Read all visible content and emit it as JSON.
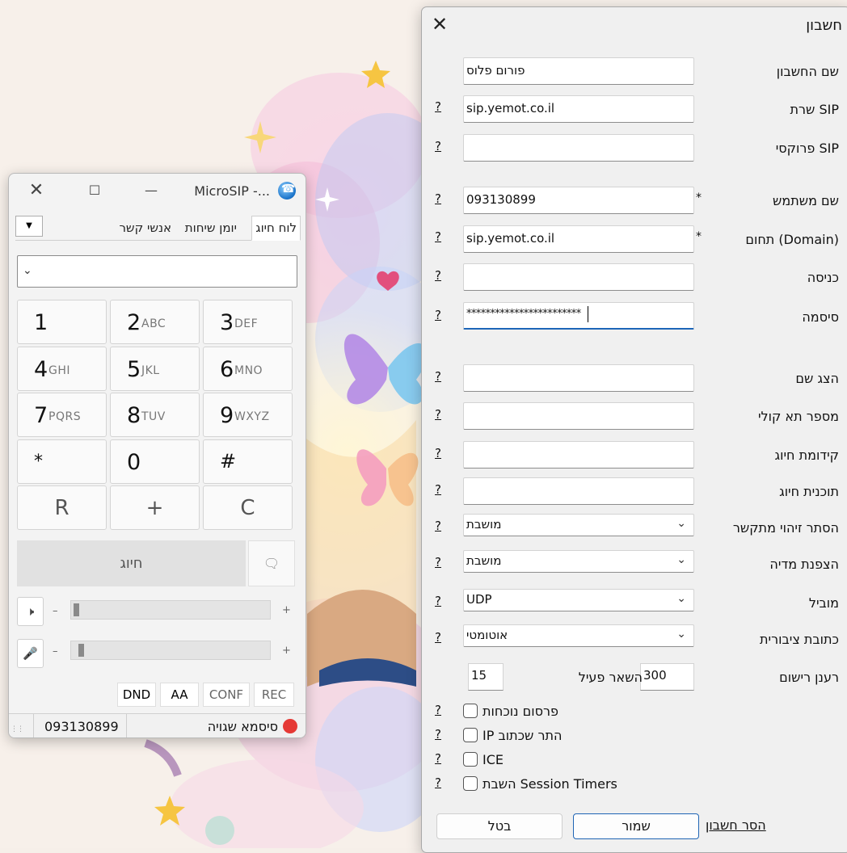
{
  "dialer": {
    "title": "MicroSIP -...",
    "tabs": [
      "לוח חיוג",
      "יומן שיחות",
      "אנשי קשר"
    ],
    "keys": [
      {
        "digit": "1",
        "letters": ""
      },
      {
        "digit": "2",
        "letters": "ABC"
      },
      {
        "digit": "3",
        "letters": "DEF"
      },
      {
        "digit": "4",
        "letters": "GHI"
      },
      {
        "digit": "5",
        "letters": "JKL"
      },
      {
        "digit": "6",
        "letters": "MNO"
      },
      {
        "digit": "7",
        "letters": "PQRS"
      },
      {
        "digit": "8",
        "letters": "TUV"
      },
      {
        "digit": "9",
        "letters": "WXYZ"
      },
      {
        "digit": "*",
        "letters": ""
      },
      {
        "digit": "0",
        "letters": ""
      },
      {
        "digit": "#",
        "letters": ""
      }
    ],
    "controls": [
      "R",
      "+",
      "C"
    ],
    "call_label": "חיוג",
    "vol_minus": "–",
    "vol_plus": "+",
    "toggles": [
      "DND",
      "AA",
      "CONF",
      "REC"
    ],
    "status_number": "093130899",
    "status_text": "סיסמא שגויה",
    "status_color": "#e53935"
  },
  "account": {
    "title": "חשבון",
    "fields": {
      "account_name": {
        "label": "שם החשבון",
        "value": "פורום פלוס"
      },
      "sip_server": {
        "label": "SIP שרת",
        "value": "sip.yemot.co.il"
      },
      "sip_proxy": {
        "label": "SIP פרוקסי",
        "value": ""
      },
      "username": {
        "label": "שם משתמש",
        "value": "093130899"
      },
      "domain": {
        "label": "(Domain) תחום",
        "value": "sip.yemot.co.il"
      },
      "login": {
        "label": "כניסה",
        "value": ""
      },
      "password": {
        "label": "סיסמה",
        "value": "************************"
      },
      "display_name": {
        "label": "הצג שם",
        "value": ""
      },
      "voicemail": {
        "label": "מספר תא קולי",
        "value": ""
      },
      "dial_prefix": {
        "label": "קידומת חיוג",
        "value": ""
      },
      "dial_plan": {
        "label": "תוכנית חיוג",
        "value": ""
      },
      "hide_cid": {
        "label": "הסתר זיהוי מתקשר",
        "value": "מושבת"
      },
      "media_encryption": {
        "label": "הצפנת מדיה",
        "value": "מושבת"
      },
      "transport": {
        "label": "מוביל",
        "value": "UDP"
      },
      "public_address": {
        "label": "כתובת ציבורית",
        "value": "אוטומטי"
      },
      "register_refresh": {
        "label": "רענן רישום",
        "value": "300"
      },
      "keep_alive": {
        "label": "השאר פעיל",
        "value": "15"
      }
    },
    "checkboxes": [
      "פרסום נוכחות",
      "IP התר שכתוב",
      "ICE",
      "השבת Session Timers"
    ],
    "help": "?",
    "required": "*",
    "buttons": {
      "remove": "הסר חשבון",
      "save": "שמור",
      "cancel": "בטל"
    }
  }
}
